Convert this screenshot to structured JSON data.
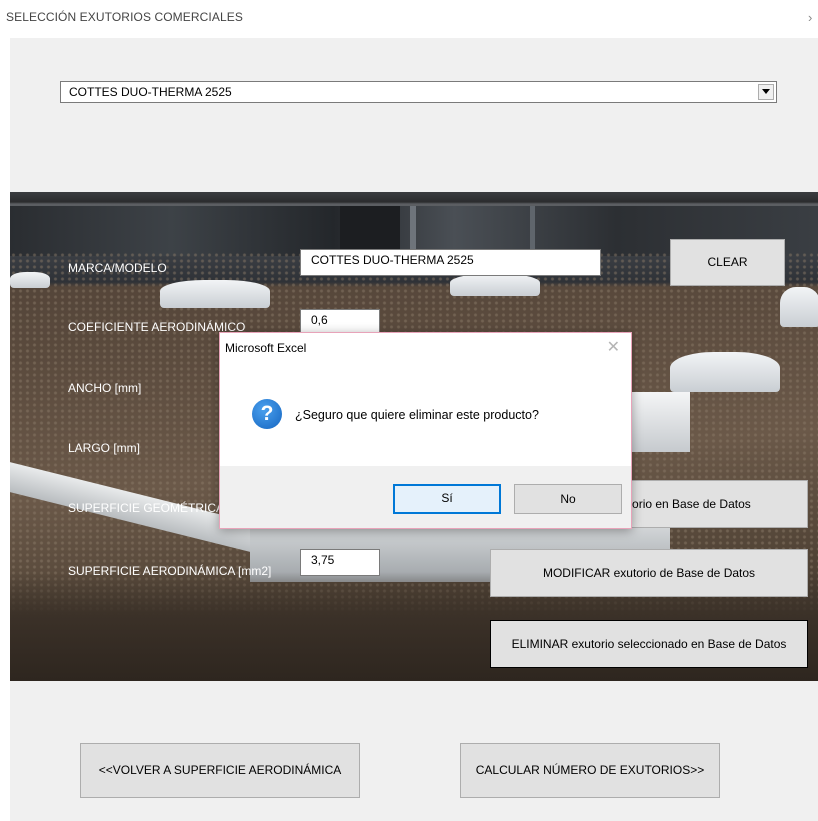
{
  "window": {
    "title": "SELECCIÓN EXUTORIOS COMERCIALES",
    "chevron_icon": "chevron-right-icon"
  },
  "combo": {
    "selected": "COTTES DUO-THERMA 2525",
    "arrow_icon": "chevron-down-icon"
  },
  "form": {
    "marca_label": "MARCA/MODELO",
    "marca_value": "COTTES DUO-THERMA 2525",
    "coef_label": "COEFICIENTE AERODINÁMICO",
    "coef_value": "0,6",
    "ancho_label": "ANCHO [mm]",
    "largo_label": "LARGO [mm]",
    "sup_geo_label": "SUPERFICIE GEOMÉTRICA",
    "sup_aero_label": "SUPERFICIE AERODINÁMICA [mm2]",
    "sup_aero_value": "3,75"
  },
  "buttons": {
    "clear": "CLEAR",
    "guardar": "GUARDAR exutorio en Base de Datos",
    "modificar": "MODIFICAR exutorio de Base de Datos",
    "eliminar": "ELIMINAR exutorio seleccionado en Base de Datos",
    "volver": "<<VOLVER A SUPERFICIE AERODINÁMICA",
    "calcular": "CALCULAR NÚMERO DE EXUTORIOS>>"
  },
  "dialog": {
    "title": "Microsoft Excel",
    "message": "¿Seguro que quiere eliminar este producto?",
    "yes": "Sí",
    "no": "No",
    "icon": "question-icon",
    "close_icon": "close-icon"
  },
  "colors": {
    "dialog_border": "#e8a3b9",
    "default_button_border": "#0078d7",
    "question_icon": "#1e6fd0"
  }
}
